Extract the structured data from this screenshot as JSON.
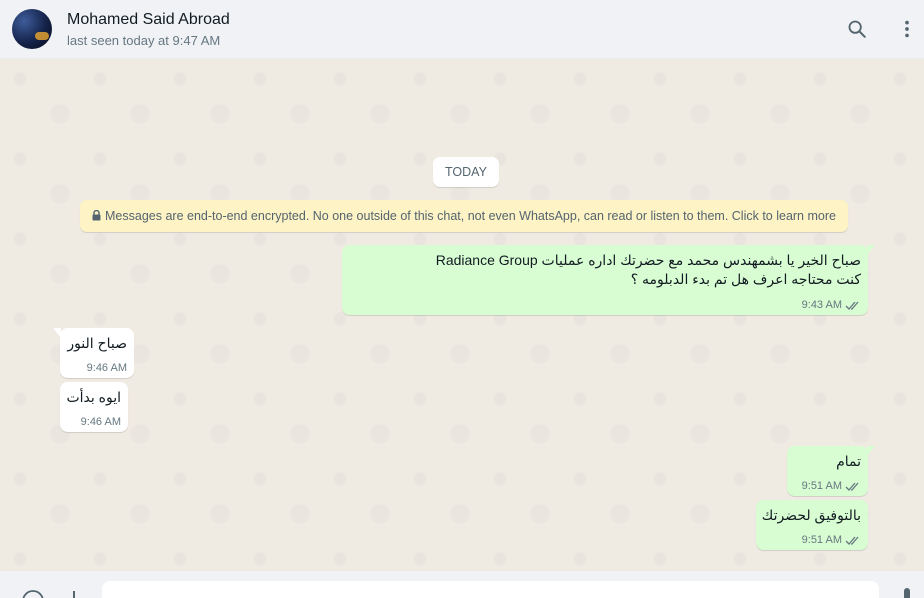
{
  "header": {
    "contact_name": "Mohamed Said Abroad",
    "status": "last seen today at 9:47 AM",
    "icons": [
      "search-icon",
      "menu-icon"
    ]
  },
  "chat": {
    "date_label": "TODAY",
    "encryption_notice": "Messages are end-to-end encrypted. No one outside of this chat, not even WhatsApp, can read or listen to them. Click to learn more",
    "messages": [
      {
        "direction": "outgoing",
        "line1": "صباح الخير يا بشمهندس محمد مع حضرتك اداره عمليات Radiance Group",
        "line2": "كنت محتاجه اعرف هل تم بدء الدبلومه ؟",
        "time": "9:43 AM",
        "status": "read"
      },
      {
        "direction": "incoming",
        "text": "صباح النور",
        "time": "9:46 AM"
      },
      {
        "direction": "incoming",
        "text": "ايوه بدأت",
        "time": "9:46 AM"
      },
      {
        "direction": "outgoing",
        "text": "تمام",
        "time": "9:51 AM",
        "status": "read"
      },
      {
        "direction": "outgoing",
        "text": "بالتوفيق لحضرتك",
        "time": "9:51 AM",
        "status": "read"
      }
    ]
  },
  "footer": {
    "icons": [
      "emoji-icon",
      "attach-icon",
      "mic-icon"
    ]
  },
  "colors": {
    "outgoing_bubble": "#d9fdd3",
    "incoming_bubble": "#ffffff",
    "chat_background": "#efeae2",
    "header_background": "#f0f2f5",
    "encryption_banner": "#fdf3c5",
    "read_tick": "#667781"
  }
}
